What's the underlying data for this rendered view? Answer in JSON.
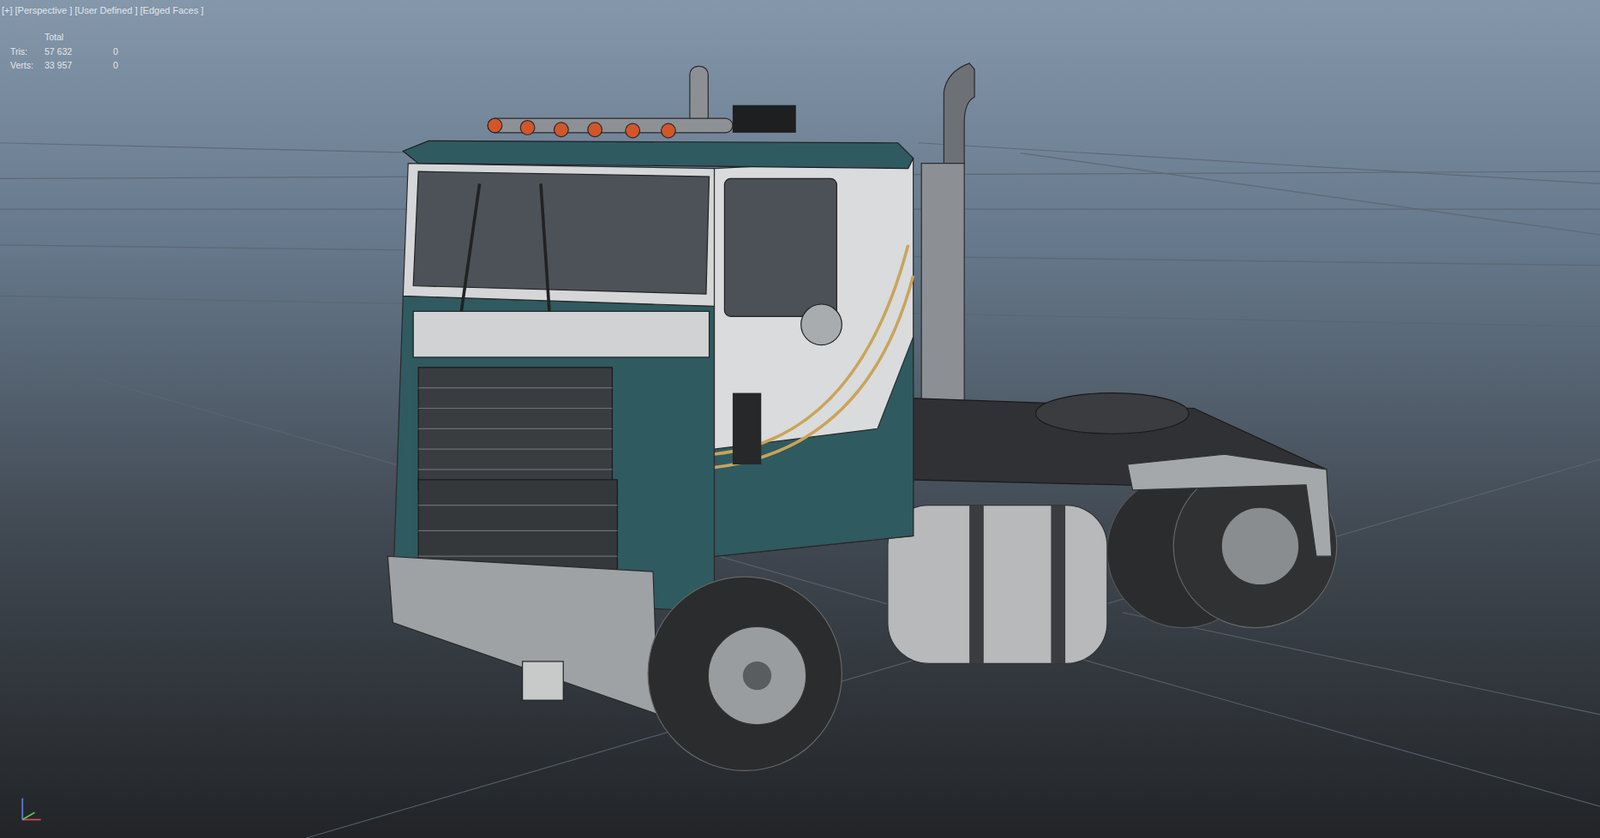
{
  "viewport": {
    "label": [
      {
        "text": "[+]"
      },
      {
        "text": "[Perspective ]"
      },
      {
        "text": "[User Defined ]"
      },
      {
        "text": "[Edged Faces ]"
      }
    ]
  },
  "stats": {
    "header": "Total",
    "rows": [
      {
        "label": "Tris:",
        "total": "57 632",
        "selected": "0"
      },
      {
        "label": "Verts:",
        "total": "33 957",
        "selected": "0"
      }
    ]
  }
}
